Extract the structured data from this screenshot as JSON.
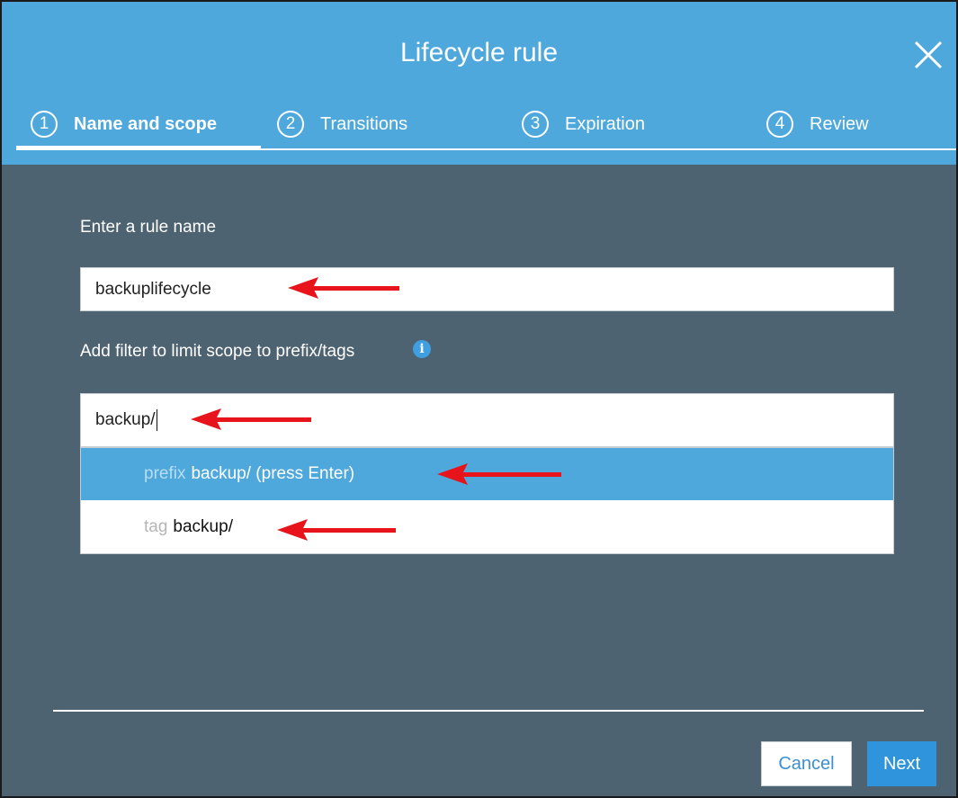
{
  "dialog": {
    "title": "Lifecycle rule"
  },
  "steps": [
    {
      "number": "1",
      "label": "Name and scope",
      "active": true
    },
    {
      "number": "2",
      "label": "Transitions",
      "active": false
    },
    {
      "number": "3",
      "label": "Expiration",
      "active": false
    },
    {
      "number": "4",
      "label": "Review",
      "active": false
    }
  ],
  "form": {
    "rule_name_label": "Enter a rule name",
    "rule_name_value": "backuplifecycle",
    "filter_label": "Add filter to limit scope to prefix/tags",
    "filter_value": "backup/"
  },
  "suggestions": [
    {
      "kind": "prefix",
      "text": "backup/ (press Enter)",
      "highlighted": true
    },
    {
      "kind": "tag",
      "text": "backup/",
      "highlighted": false
    }
  ],
  "footer": {
    "cancel_label": "Cancel",
    "next_label": "Next"
  },
  "colors": {
    "header": "#4ea8dc",
    "body": "#4e6371",
    "annotation_arrow": "#e8141b",
    "primary_button": "#2f94dc"
  }
}
